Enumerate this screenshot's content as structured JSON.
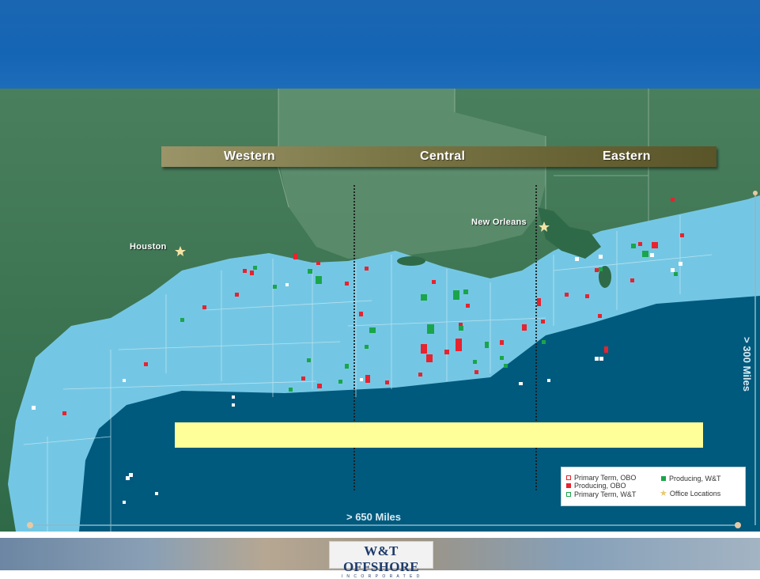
{
  "regions": {
    "western": "Western",
    "central": "Central",
    "eastern": "Eastern"
  },
  "cities": {
    "houston": "Houston",
    "new_orleans": "New Orleans"
  },
  "distances": {
    "horizontal": "> 650 Miles",
    "vertical": "> 300 Miles"
  },
  "legend": {
    "primary_term_obo": "Primary Term, OBO",
    "producing_obo": "Producing, OBO",
    "primary_term_wt": "Primary Term, W&T",
    "producing_wt": "Producing, W&T",
    "office_locations": "Office Locations"
  },
  "colors": {
    "obo": "#e8222e",
    "wt": "#1aa54a",
    "deep_water": "#005a7d",
    "shelf": "#74c7e4",
    "land": "#3f7a58",
    "header": "#1565b5"
  },
  "logo": {
    "name": "W&T OFFSHORE",
    "tagline": "I N C O R P O R A T E D"
  }
}
